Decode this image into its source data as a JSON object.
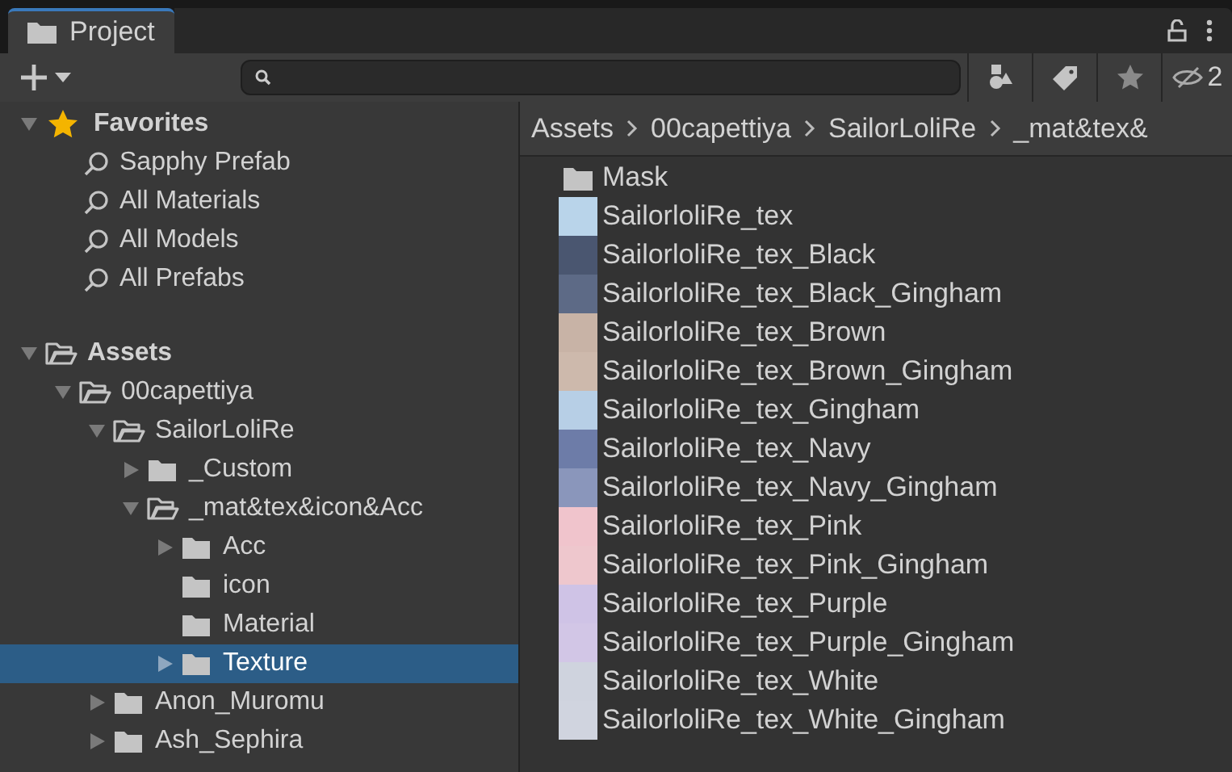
{
  "tab": {
    "label": "Project",
    "selected": true
  },
  "toolbar": {
    "hidden_count": "2"
  },
  "favorites": {
    "label": "Favorites",
    "expanded": true,
    "items": [
      "Sapphy Prefab",
      "All Materials",
      "All Models",
      "All Prefabs"
    ]
  },
  "tree": [
    {
      "label": "Assets",
      "expanded": true,
      "selected": false,
      "children": [
        {
          "label": "00capettiya",
          "expanded": true,
          "selected": false,
          "children": [
            {
              "label": "SailorLoliRe",
              "expanded": true,
              "selected": false,
              "children": [
                {
                  "label": "_Custom",
                  "expanded": false,
                  "selected": false
                },
                {
                  "label": "_mat&tex&icon&Acc",
                  "expanded": true,
                  "selected": false,
                  "children": [
                    {
                      "label": "Acc",
                      "expanded": false,
                      "selected": false
                    },
                    {
                      "label": "icon",
                      "selected": false
                    },
                    {
                      "label": "Material",
                      "selected": false
                    },
                    {
                      "label": "Texture",
                      "expanded": false,
                      "selected": true
                    }
                  ]
                }
              ]
            },
            {
              "label": "Anon_Muromu",
              "expanded": false,
              "selected": false
            },
            {
              "label": "Ash_Sephira",
              "expanded": false,
              "selected": false
            }
          ]
        }
      ]
    }
  ],
  "breadcrumb": [
    "Assets",
    "00capettiya",
    "SailorLoliRe",
    "_mat&tex&"
  ],
  "files": [
    {
      "name": "Mask",
      "kind": "folder"
    },
    {
      "name": "SailorloliRe_tex",
      "kind": "texture",
      "color": "#b9d4ea"
    },
    {
      "name": "SailorloliRe_tex_Black",
      "kind": "texture",
      "color": "#4a5670"
    },
    {
      "name": "SailorloliRe_tex_Black_Gingham",
      "kind": "texture",
      "color": "#5d6a86"
    },
    {
      "name": "SailorloliRe_tex_Brown",
      "kind": "texture",
      "color": "#c8b3a6"
    },
    {
      "name": "SailorloliRe_tex_Brown_Gingham",
      "kind": "texture",
      "color": "#cdb9ac"
    },
    {
      "name": "SailorloliRe_tex_Gingham",
      "kind": "texture",
      "color": "#b7cfe6"
    },
    {
      "name": "SailorloliRe_tex_Navy",
      "kind": "texture",
      "color": "#6d7ca8"
    },
    {
      "name": "SailorloliRe_tex_Navy_Gingham",
      "kind": "texture",
      "color": "#8a96bb"
    },
    {
      "name": "SailorloliRe_tex_Pink",
      "kind": "texture",
      "color": "#f0c4cc"
    },
    {
      "name": "SailorloliRe_tex_Pink_Gingham",
      "kind": "texture",
      "color": "#eec7cd"
    },
    {
      "name": "SailorloliRe_tex_Purple",
      "kind": "texture",
      "color": "#cfc3e6"
    },
    {
      "name": "SailorloliRe_tex_Purple_Gingham",
      "kind": "texture",
      "color": "#d2c6e6"
    },
    {
      "name": "SailorloliRe_tex_White",
      "kind": "texture",
      "color": "#cfd3de"
    },
    {
      "name": "SailorloliRe_tex_White_Gingham",
      "kind": "texture",
      "color": "#d0d4df"
    }
  ]
}
